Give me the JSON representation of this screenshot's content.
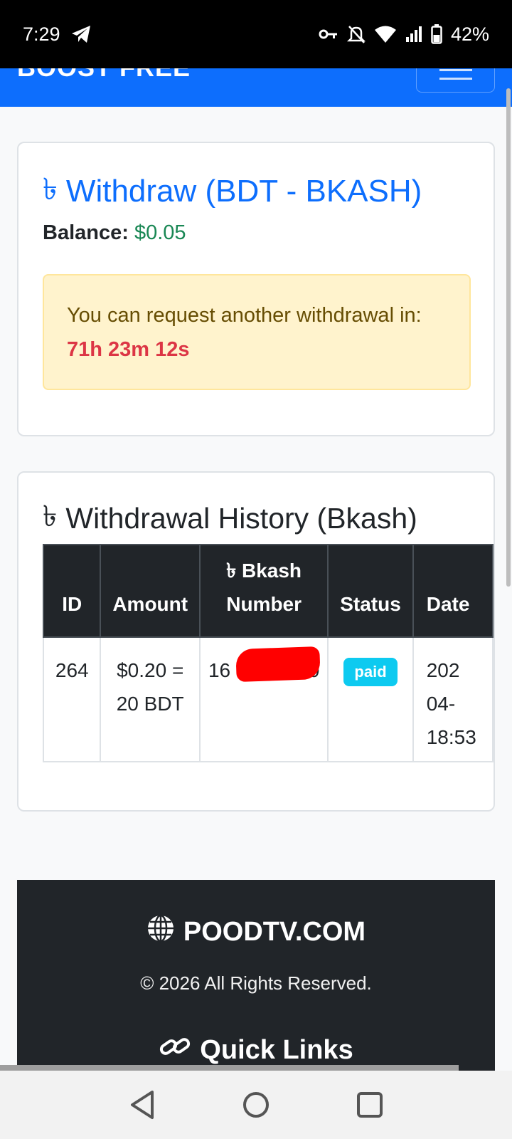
{
  "status_bar": {
    "time": "7:29",
    "battery": "42%",
    "icons": [
      "telegram-icon",
      "vpn-key-icon",
      "bell-off-icon",
      "wifi-icon",
      "signal-icon",
      "battery-icon"
    ]
  },
  "navbar": {
    "brand": "BOOST FREE",
    "toggler_icon": "hamburger-menu-icon"
  },
  "withdraw": {
    "currency_symbol": "৳",
    "title": "Withdraw (BDT - BKASH)",
    "balance_label": "Balance:",
    "balance_value": "$0.05",
    "alert_text": "You can request another withdrawal in:",
    "alert_timer": "71h 23m 12s"
  },
  "history": {
    "currency_symbol": "৳",
    "title": "Withdrawal History (Bkash)",
    "headers": {
      "id": "ID",
      "amount": "Amount",
      "number_symbol": "৳",
      "number_line1": "Bkash",
      "number_line2": "Number",
      "status": "Status",
      "date": "Date"
    },
    "rows": [
      {
        "id": "264",
        "amount_line1": "$0.20 =",
        "amount_line2": "20 BDT",
        "number_start": "16",
        "number_end": "70",
        "status": "paid",
        "date_line1": "202",
        "date_line2": "04-",
        "date_line3": "18:53"
      }
    ]
  },
  "footer": {
    "brand": "POODTV.COM",
    "copyright": "© 2026 All Rights Reserved.",
    "quick_links": "Quick Links"
  },
  "colors": {
    "primary": "#0d6efd",
    "success": "#198754",
    "danger": "#dc3545",
    "info": "#0dcaf0",
    "dark": "#212529",
    "warning_bg": "#fff3cd"
  }
}
